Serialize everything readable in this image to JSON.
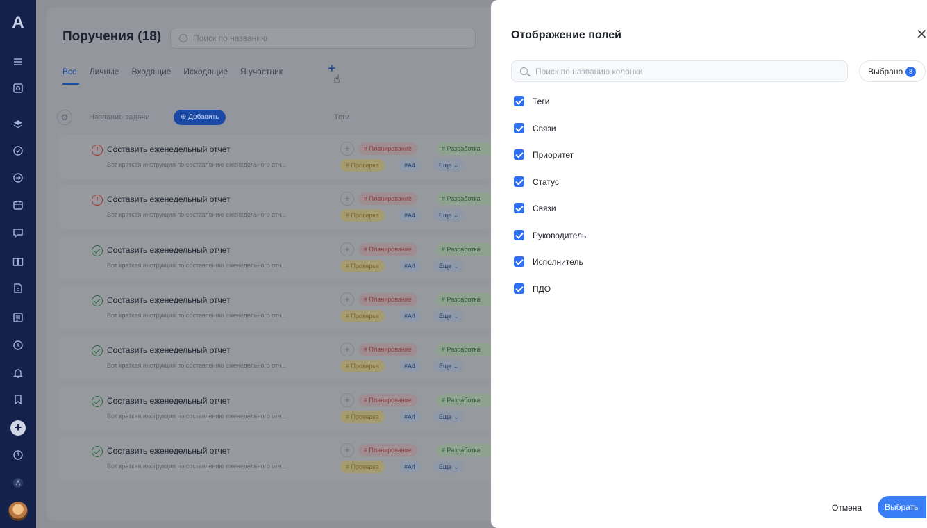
{
  "background": {
    "title": "Поручения (18)",
    "search_placeholder": "Поиск по названию",
    "tabs": [
      "Все",
      "Личные",
      "Входящие",
      "Исходящие",
      "Я участник"
    ],
    "active_tab": "Все",
    "table": {
      "col_name": "Название задачи",
      "add_label": "Добавить",
      "col_tags": "Теги"
    },
    "rows": [
      {
        "status": "warning",
        "title": "Составить еженедельный отчет",
        "desc": "Вот краткая инструкция по составлению еженедельного отч...",
        "tags": [
          "# Планирование",
          "# Разработка",
          "# Проверка",
          "#А4",
          "Еще"
        ]
      },
      {
        "status": "warning",
        "title": "Составить еженедельный отчет",
        "desc": "Вот краткая инструкция по составлению еженедельного отч...",
        "tags": [
          "# Планирование",
          "# Разработка",
          "# Проверка",
          "#А4",
          "Еще"
        ]
      },
      {
        "status": "done",
        "title": "Составить еженедельный отчет",
        "desc": "Вот краткая инструкция по составлению еженедельного отч...",
        "tags": [
          "# Планирование",
          "# Разработка",
          "# Проверка",
          "#А4",
          "Еще"
        ]
      },
      {
        "status": "done",
        "title": "Составить еженедельный отчет",
        "desc": "Вот краткая инструкция по составлению еженедельного отч...",
        "tags": [
          "# Планирование",
          "# Разработка",
          "# Проверка",
          "#А4",
          "Еще"
        ]
      },
      {
        "status": "done",
        "title": "Составить еженедельный отчет",
        "desc": "Вот краткая инструкция по составлению еженедельного отч...",
        "tags": [
          "# Планирование",
          "# Разработка",
          "# Проверка",
          "#А4",
          "Еще"
        ]
      },
      {
        "status": "done",
        "title": "Составить еженедельный отчет",
        "desc": "Вот краткая инструкция по составлению еженедельного отч...",
        "tags": [
          "# Планирование",
          "# Разработка",
          "# Проверка",
          "#А4",
          "Еще"
        ]
      },
      {
        "status": "done",
        "title": "Составить еженедельный отчет",
        "desc": "Вот краткая инструкция по составлению еженедельного отч...",
        "tags": [
          "# Планирование",
          "# Разработка",
          "# Проверка",
          "#А4",
          "Еще"
        ]
      }
    ]
  },
  "modal": {
    "title": "Отображение полей",
    "search_placeholder": "Поиск по названию колонки",
    "selected_label": "Выбрано",
    "selected_count": "8",
    "fields": [
      {
        "label": "Теги",
        "checked": true
      },
      {
        "label": "Связи",
        "checked": true
      },
      {
        "label": "Приоритет",
        "checked": true
      },
      {
        "label": "Статус",
        "checked": true
      },
      {
        "label": "Связи",
        "checked": true
      },
      {
        "label": "Руководитель",
        "checked": true
      },
      {
        "label": "Исполнитель",
        "checked": true
      },
      {
        "label": "ПДО",
        "checked": true
      }
    ],
    "cancel_label": "Отмена",
    "confirm_label": "Выбрать"
  },
  "colors": {
    "accent": "#2f6ff2",
    "sidebar": "#14214a",
    "overlay": "#8d9096"
  }
}
